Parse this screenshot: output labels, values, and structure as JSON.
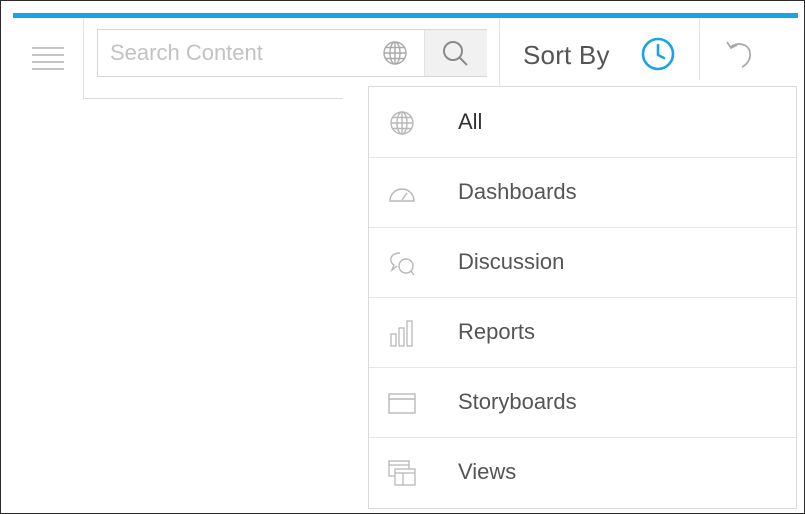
{
  "search": {
    "placeholder": "Search Content",
    "value": ""
  },
  "sort": {
    "label": "Sort By"
  },
  "filter_menu": {
    "items": [
      {
        "label": "All",
        "icon": "globe-icon",
        "selected": true
      },
      {
        "label": "Dashboards",
        "icon": "gauge-icon",
        "selected": false
      },
      {
        "label": "Discussion",
        "icon": "chat-bubbles-icon",
        "selected": false
      },
      {
        "label": "Reports",
        "icon": "bar-chart-icon",
        "selected": false
      },
      {
        "label": "Storyboards",
        "icon": "storyboard-icon",
        "selected": false
      },
      {
        "label": "Views",
        "icon": "views-icon",
        "selected": false
      }
    ]
  },
  "colors": {
    "accent": "#1aa3e8",
    "icon_gray": "#c4c4c4",
    "text": "#555555"
  }
}
